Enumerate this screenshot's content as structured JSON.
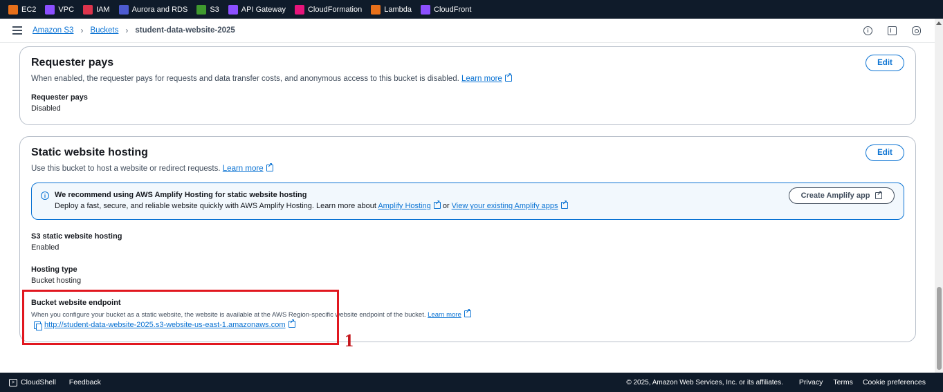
{
  "service_bar": {
    "items": [
      {
        "label": "EC2",
        "icon": "ec2-icon",
        "color": "#e8701a"
      },
      {
        "label": "VPC",
        "icon": "vpc-icon",
        "color": "#8c4fff"
      },
      {
        "label": "IAM",
        "icon": "iam-icon",
        "color": "#dd344c"
      },
      {
        "label": "Aurora and RDS",
        "icon": "rds-icon",
        "color": "#4d5bd1"
      },
      {
        "label": "S3",
        "icon": "s3-icon",
        "color": "#3f9a2e"
      },
      {
        "label": "API Gateway",
        "icon": "api-gateway-icon",
        "color": "#8c4fff"
      },
      {
        "label": "CloudFormation",
        "icon": "cloudformation-icon",
        "color": "#e7157b"
      },
      {
        "label": "Lambda",
        "icon": "lambda-icon",
        "color": "#e8701a"
      },
      {
        "label": "CloudFront",
        "icon": "cloudfront-icon",
        "color": "#8c4fff"
      }
    ]
  },
  "breadcrumb": {
    "items": [
      "Amazon S3",
      "Buckets"
    ],
    "current": "student-data-website-2025"
  },
  "requester_pays": {
    "title": "Requester pays",
    "description": "When enabled, the requester pays for requests and data transfer costs, and anonymous access to this bucket is disabled.",
    "learn_more": "Learn more",
    "edit_label": "Edit",
    "field_label": "Requester pays",
    "field_value": "Disabled"
  },
  "static_hosting": {
    "title": "Static website hosting",
    "description": "Use this bucket to host a website or redirect requests.",
    "learn_more": "Learn more",
    "edit_label": "Edit",
    "info": {
      "title": "We recommend using AWS Amplify Hosting for static website hosting",
      "text": "Deploy a fast, secure, and reliable website quickly with AWS Amplify Hosting. Learn more about",
      "link1": "Amplify Hosting",
      "or": "or",
      "link2": "View your existing Amplify apps",
      "button": "Create Amplify app"
    },
    "hosting_label": "S3 static website hosting",
    "hosting_value": "Enabled",
    "type_label": "Hosting type",
    "type_value": "Bucket hosting",
    "endpoint_label": "Bucket website endpoint",
    "endpoint_desc": "When you configure your bucket as a static website, the website is available at the AWS Region-specific website endpoint of the bucket.",
    "endpoint_learn_more": "Learn more",
    "endpoint_url": "http://student-data-website-2025.s3-website-us-east-1.amazonaws.com"
  },
  "annotation": {
    "number": "1",
    "color": "#e1171f"
  },
  "footer": {
    "cloudshell": "CloudShell",
    "feedback": "Feedback",
    "copyright": "© 2025, Amazon Web Services, Inc. or its affiliates.",
    "privacy": "Privacy",
    "terms": "Terms",
    "cookies": "Cookie preferences"
  }
}
